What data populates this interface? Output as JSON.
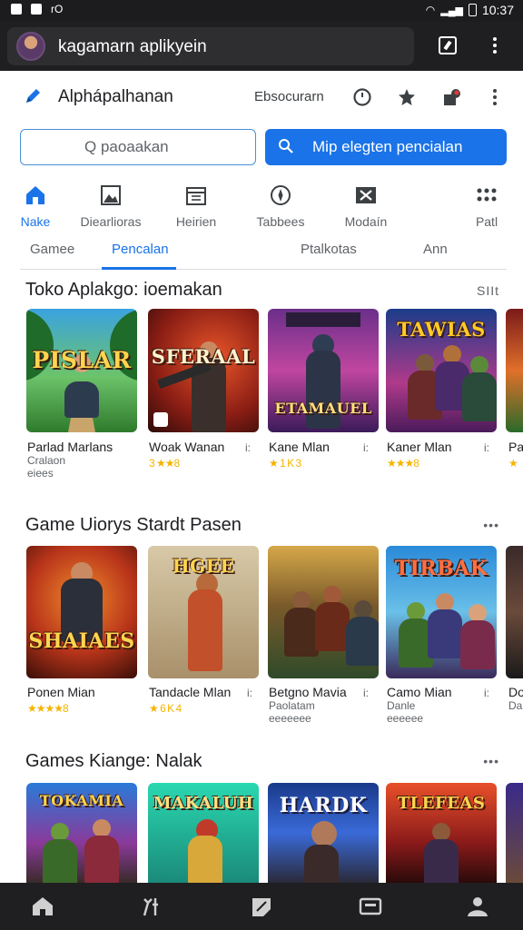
{
  "status_bar": {
    "time": "10:37"
  },
  "browser": {
    "url_title": "kagamarn aplikyein"
  },
  "header": {
    "title": "Alphápalhanan",
    "link": "Ebsocurarn"
  },
  "search": {
    "placeholder": "Q paoaakan",
    "button_label": "Mip elegten pencialan"
  },
  "categories": [
    {
      "label": "Nake",
      "icon": "home-icon",
      "active": true
    },
    {
      "label": "Diearlioras",
      "icon": "image-icon"
    },
    {
      "label": "Heirien",
      "icon": "calendar-icon"
    },
    {
      "label": "Tabbees",
      "icon": "compass-icon"
    },
    {
      "label": "Modaín",
      "icon": "close-box-icon"
    },
    {
      "label": "Patl",
      "icon": "apps-icon"
    }
  ],
  "tabs": [
    {
      "label": "Gamee"
    },
    {
      "label": "Pencalan",
      "active": true
    },
    {
      "label": "Ptalkotas"
    },
    {
      "label": "Ann"
    }
  ],
  "sections": [
    {
      "title": "Toko Aplakgo: ioemakan",
      "more": "SIIt",
      "games": [
        {
          "art": "PISLAR",
          "name": "Parlad Marlans",
          "sub": "Cralaon",
          "rating": "eiees"
        },
        {
          "art": "SFERAAL",
          "name": "Woak Wanan",
          "rating": "3 ★★8"
        },
        {
          "art": "ETAMAUEL",
          "name": "Kane Mlan",
          "rating": "★ 1 K 3"
        },
        {
          "art": "TAWIAS",
          "name": "Kaner Mlan",
          "rating": "★★★8"
        },
        {
          "art": "",
          "name": "Pa",
          "rating": "★"
        }
      ]
    },
    {
      "title": "Game Uiorys Stardt Pasen",
      "more": "•••",
      "games": [
        {
          "art": "SHAIAES",
          "name": "Ponen Mian",
          "rating": "★★★★8"
        },
        {
          "art": "HGEE",
          "name": "Tandacle Mlan",
          "rating": "★ 6 K 4"
        },
        {
          "art": "",
          "name": "Betgno Mavia",
          "sub": "Paolatam",
          "rating": "eeeeeee"
        },
        {
          "art": "TIRBAK",
          "name": "Camo Mian",
          "sub": "Danle",
          "rating": "eeeeee"
        },
        {
          "art": "",
          "name": "Do",
          "sub": "Da"
        }
      ]
    },
    {
      "title": "Games Kiange: Nalak",
      "more": "•••",
      "games": [
        {
          "art": "TOKAMIA",
          "name": ""
        },
        {
          "art": "MAKALUH",
          "name": ""
        },
        {
          "art": "HARDK",
          "name": ""
        },
        {
          "art": "TLEFEAS",
          "name": ""
        },
        {
          "art": "",
          "name": ""
        }
      ]
    }
  ],
  "bottom_nav": [
    {
      "icon": "home-icon"
    },
    {
      "icon": "tools-icon"
    },
    {
      "icon": "note-icon"
    },
    {
      "icon": "tv-icon"
    },
    {
      "icon": "person-icon"
    }
  ],
  "colors": {
    "accent": "#1a73e8",
    "bar_dark": "#1f1f21",
    "star": "#f4b400"
  }
}
